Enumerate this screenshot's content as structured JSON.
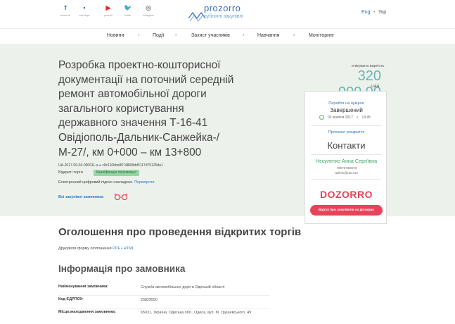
{
  "social": [
    {
      "glyph": "f",
      "label": "facebook",
      "icon": "facebook-icon"
    },
    {
      "glyph": "▪",
      "label": "videotape",
      "icon": "document-icon"
    },
    {
      "glyph": "▶",
      "label": "youtube",
      "icon": "youtube-icon"
    },
    {
      "glyph": "🐦",
      "label": "twitter",
      "icon": "twitter-icon"
    },
    {
      "glyph": "◎",
      "label": "instagram",
      "icon": "instagram-icon"
    }
  ],
  "logo": {
    "name": "prozorro",
    "tagline": "публічні закупівлі"
  },
  "lang": {
    "en": "Eng",
    "sep": "•",
    "uk": "Укр"
  },
  "nav": [
    "Новини",
    "Події",
    "Захист учасників",
    "Навчання",
    "Моніторинг"
  ],
  "tender": {
    "title": "Розробка проектно-кошторисної документації на поточний середній ремонт автомобільної дороги загального користування державного значення Т-16-41 Овідіополь-Дальник-Санжейка-/М-27/, км 0+000 – км 13+800",
    "id": "UA-2017-09-04-000611-a",
    "hash": "c8c110bbe8074868bbf5117d75125da1",
    "status_label": "Відкриті торги",
    "badge": "Кваліфікація переможця",
    "signature_text": "Електронний цифровий підпис накладено.",
    "signature_link": "Перевірити",
    "all_purchases": "Всі закупівлі замовника",
    "estimate_label": "очікувана вартість",
    "estimate_value": "320 000,00",
    "currency": "UAH"
  },
  "card": {
    "auction_link": "Перейти на аукціон",
    "auction_status": "Завершений",
    "date": "02 жовтня 2017",
    "time": "13:45",
    "protocol_link": "Протокол розкриття",
    "contacts_title": "Контакти",
    "contact_name": "Нєсуленко Анна Сергіївна",
    "phone": "+0972732673",
    "email": "admin@ukr.net",
    "dozorro": "DOZORRO",
    "dozorro_button": "Відгук про закупівлю на Дозорро"
  },
  "body": {
    "heading": "Оголошення про проведення відкритих торгів",
    "print_text": "Друкувати форму оголошення",
    "print_pdf": "PDF",
    "print_sep": "•",
    "print_html": "HTML",
    "customer_heading": "Інформація про замовника",
    "rows": [
      {
        "k": "Найменування замовника:",
        "v": "Служба автомобільних доріг в Одеській області"
      },
      {
        "k": "Код ЄДРПОУ:",
        "v": "25829550"
      },
      {
        "k": "Місцезнаходження замовника:",
        "v": "65031, Україна, Одеська обл., Одеса, вул. М. Грушевського, 49"
      }
    ]
  }
}
